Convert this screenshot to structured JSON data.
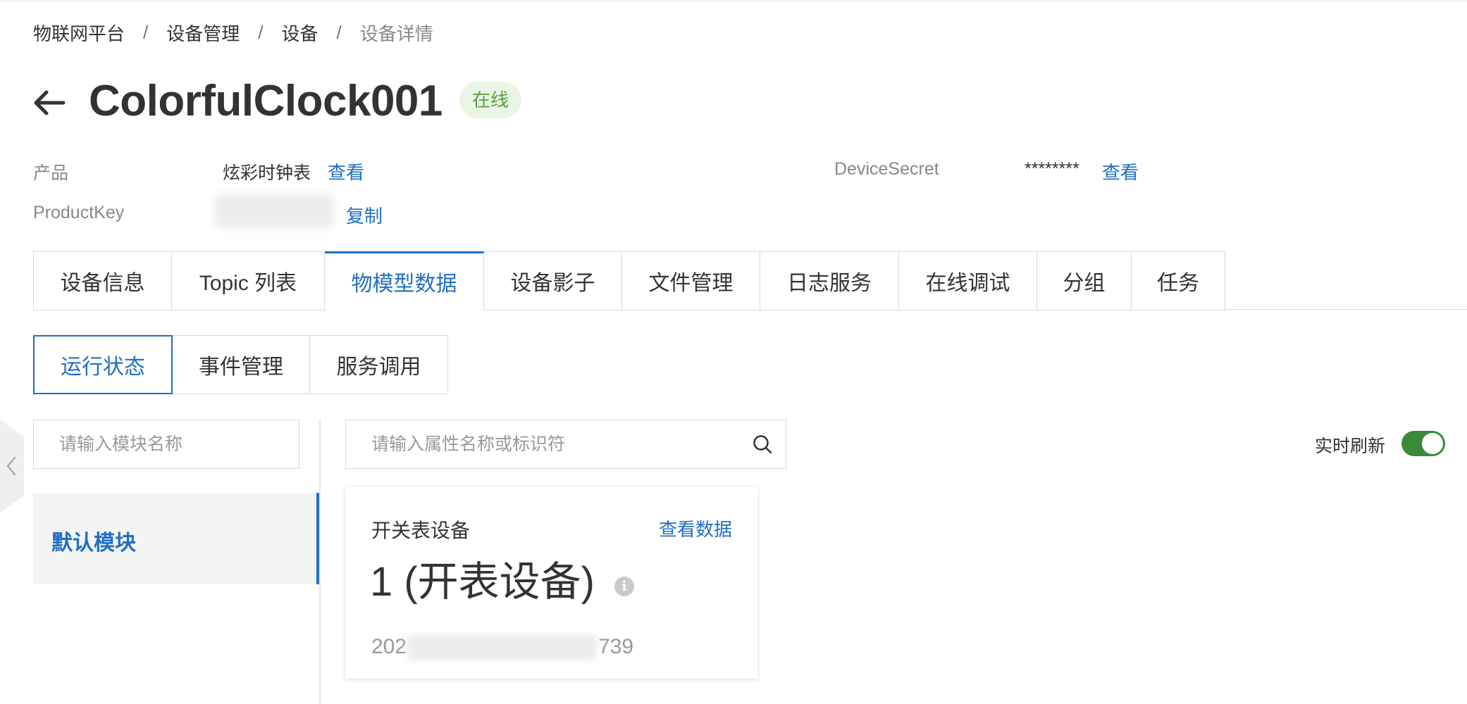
{
  "breadcrumb": {
    "items": [
      "物联网平台",
      "设备管理",
      "设备",
      "设备详情"
    ],
    "separator": "/"
  },
  "device": {
    "name": "ColorfulClock001",
    "status": "在线"
  },
  "info": {
    "product_label": "产品",
    "product_value": "炫彩时钟表",
    "product_link": "查看",
    "productkey_label": "ProductKey",
    "productkey_link": "复制",
    "secret_label": "DeviceSecret",
    "secret_value": "********",
    "secret_link": "查看"
  },
  "main_tabs": [
    "设备信息",
    "Topic 列表",
    "物模型数据",
    "设备影子",
    "文件管理",
    "日志服务",
    "在线调试",
    "分组",
    "任务"
  ],
  "active_main_tab": "物模型数据",
  "sub_tabs": [
    "运行状态",
    "事件管理",
    "服务调用"
  ],
  "active_sub_tab": "运行状态",
  "module_search": {
    "placeholder": "请输入模块名称"
  },
  "modules": [
    "默认模块"
  ],
  "property_search": {
    "placeholder": "请输入属性名称或标识符"
  },
  "realtime_refresh": {
    "label": "实时刷新",
    "enabled": true
  },
  "property_card": {
    "name": "开关表设备",
    "link": "查看数据",
    "value": "1 (开表设备)",
    "time_prefix": "202",
    "time_suffix": "739"
  },
  "colors": {
    "accent": "#1f6fc5",
    "online_bg": "#eaf5e6",
    "online_text": "#5aa03a",
    "toggle_on": "#3a8a3a"
  },
  "icons": [
    "back-arrow-icon",
    "search-icon",
    "chevron-left-icon",
    "info-icon"
  ]
}
